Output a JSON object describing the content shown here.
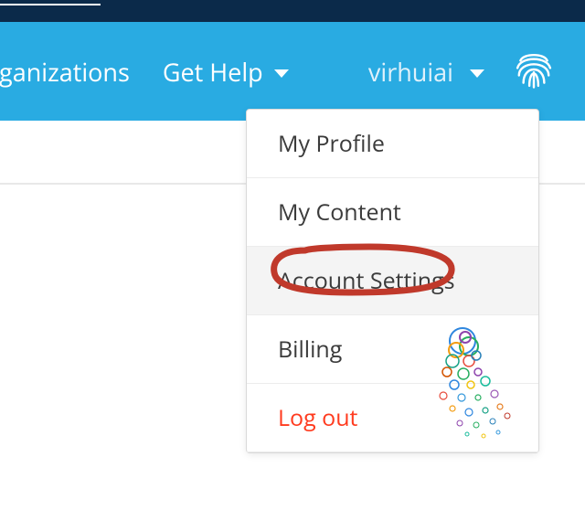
{
  "nav": {
    "organizations_label": "rganizations",
    "get_help_label": "Get Help",
    "username": "virhuiai"
  },
  "dropdown": {
    "items": [
      {
        "label": "My Profile"
      },
      {
        "label": "My Content"
      },
      {
        "label": "Account Settings"
      },
      {
        "label": "Billing"
      },
      {
        "label": "Log out"
      }
    ]
  },
  "colors": {
    "topbar": "#0b2a4a",
    "navbar": "#29abe2",
    "accent_red": "#c0392b",
    "logout_text": "#ff3b1f"
  }
}
